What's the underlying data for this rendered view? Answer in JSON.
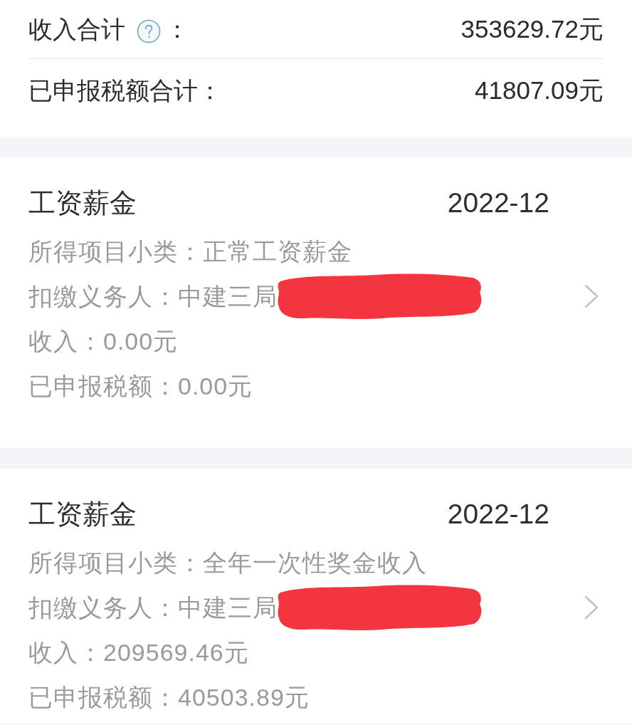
{
  "summary": [
    {
      "label": "收入合计",
      "help": true,
      "label_end": "：",
      "value": "353629.72元"
    },
    {
      "label": "已申报税额合计：",
      "help": false,
      "value": "41807.09元"
    }
  ],
  "records": [
    {
      "title": "工资薪金",
      "period": "2022-12",
      "fields": [
        {
          "text": "所得项目小类：正常工资薪金",
          "redacted": false,
          "arrow": false
        },
        {
          "text": "扣缴义务人：中建三局",
          "redacted": true,
          "arrow": true
        },
        {
          "text": "收入：0.00元",
          "redacted": false,
          "arrow": false
        },
        {
          "text": "已申报税额：0.00元",
          "redacted": false,
          "arrow": false
        }
      ]
    },
    {
      "title": "工资薪金",
      "period": "2022-12",
      "fields": [
        {
          "text": "所得项目小类：全年一次性奖金收入",
          "redacted": false,
          "arrow": false
        },
        {
          "text": "扣缴义务人：中建三局",
          "redacted": true,
          "arrow": true
        },
        {
          "text": "收入：209569.46元",
          "redacted": false,
          "arrow": false
        },
        {
          "text": "已申报税额：40503.89元",
          "redacted": false,
          "arrow": false
        }
      ]
    }
  ]
}
